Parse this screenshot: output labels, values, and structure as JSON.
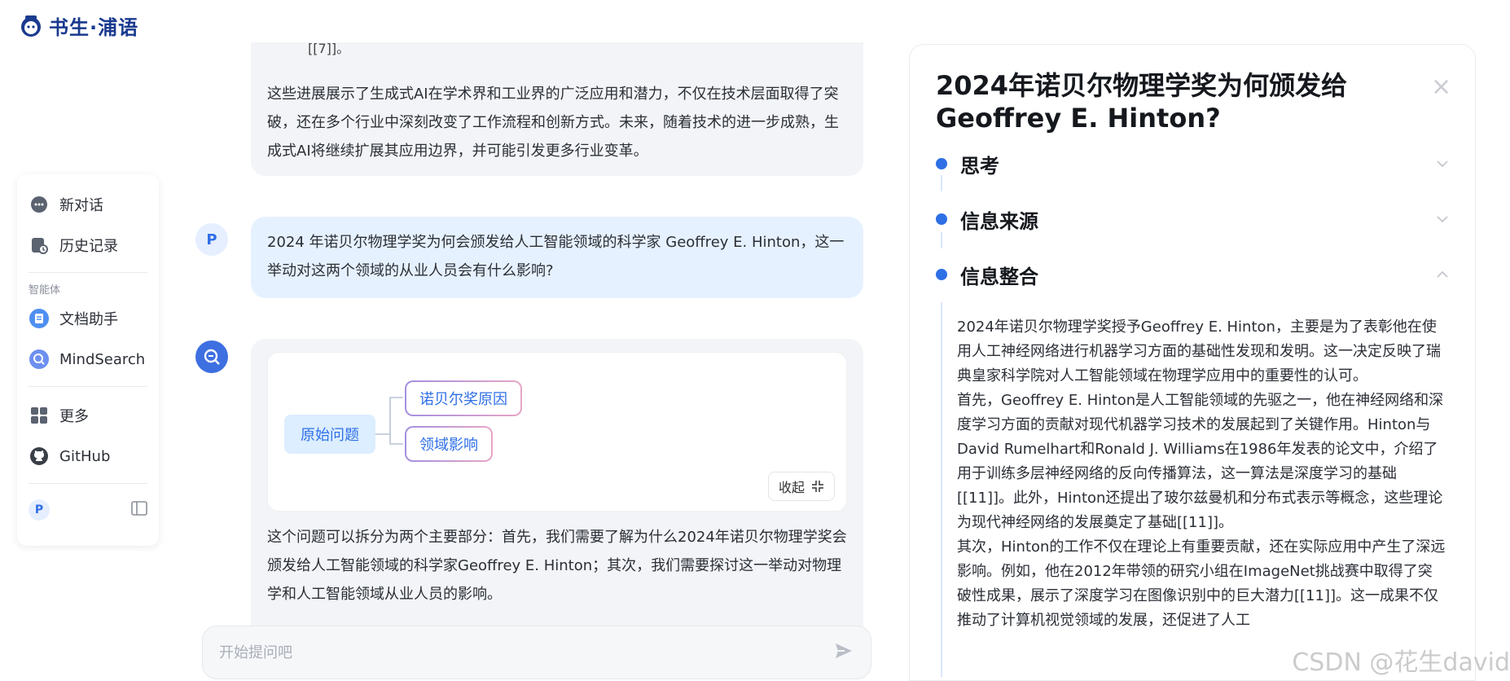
{
  "brand": {
    "name": "书生·浦语"
  },
  "sidebar": {
    "new_chat": "新对话",
    "history": "历史记录",
    "agents_caption": "智能体",
    "agents": [
      {
        "label": "文档助手",
        "icon": "document-assistant-icon"
      },
      {
        "label": "MindSearch",
        "icon": "mindsearch-icon"
      }
    ],
    "more": "更多",
    "github": "GitHub",
    "user_initial": "P"
  },
  "chat": {
    "prev_cut": "[[7]]。",
    "prev_paragraph": "这些进展展示了生成式AI在学术界和工业界的广泛应用和潜力，不仅在技术层面取得了突破，还在多个行业中深刻改变了工作流程和创新方式。未来，随着技术的进一步成熟，生成式AI将继续扩展其应用边界，并可能引发更多行业变革。",
    "user_initial": "P",
    "user_question": "2024 年诺贝尔物理学奖为何会颁发给人工智能领域的科学家 Geoffrey E. Hinton，这一举动对这两个领域的从业人员会有什么影响?",
    "mindmap": {
      "root": "原始问题",
      "children": [
        "诺贝尔奖原因",
        "领域影响"
      ],
      "collapse_label": "收起"
    },
    "answer": "这个问题可以拆分为两个主要部分：首先，我们需要了解为什么2024年诺贝尔物理学奖会颁发给人工智能领域的科学家Geoffrey E. Hinton；其次，我们需要探讨这一举动对物理学和人工智能领域从业人员的影响。",
    "input_placeholder": "开始提问吧"
  },
  "panel": {
    "title": "2024年诺贝尔物理学奖为何颁发给Geoffrey E. Hinton?",
    "sections": [
      "思考",
      "信息来源",
      "信息整合"
    ],
    "body": "2024年诺贝尔物理学奖授予Geoffrey E. Hinton，主要是为了表彰他在使用人工神经网络进行机器学习方面的基础性发现和发明。这一决定反映了瑞典皇家科学院对人工智能领域在物理学应用中的重要性的认可。\n首先，Geoffrey E. Hinton是人工智能领域的先驱之一，他在神经网络和深度学习方面的贡献对现代机器学习技术的发展起到了关键作用。Hinton与David Rumelhart和Ronald J. Williams在1986年发表的论文中，介绍了用于训练多层神经网络的反向传播算法，这一算法是深度学习的基础[[11]]。此外，Hinton还提出了玻尔兹曼机和分布式表示等概念，这些理论为现代神经网络的发展奠定了基础[[11]]。\n其次，Hinton的工作不仅在理论上有重要贡献，还在实际应用中产生了深远影响。例如，他在2012年带领的研究小组在ImageNet挑战赛中取得了突破性成果，展示了深度学习在图像识别中的巨大潜力[[11]]。这一成果不仅推动了计算机视觉领域的发展，还促进了人工"
  },
  "watermark": "CSDN @花生david",
  "colors": {
    "accent": "#2e6fe6",
    "user_bubble": "#e6f1ff",
    "bot_bubble": "#f2f4f7"
  }
}
